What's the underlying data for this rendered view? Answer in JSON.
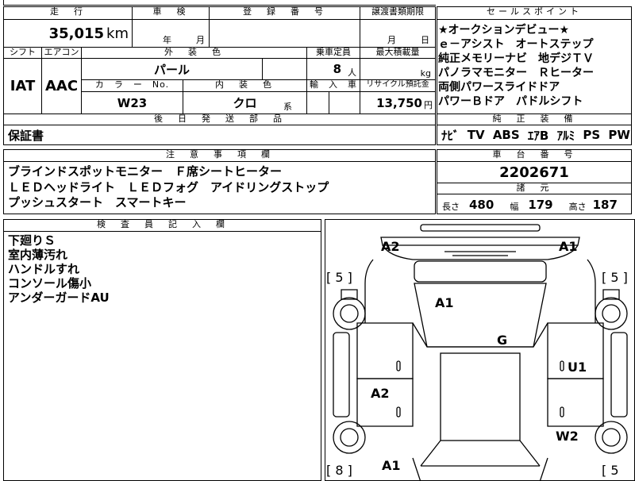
{
  "top_row": {
    "mileage_label": "走　行",
    "shaken_label": "車　検",
    "reg_label": "登　録　番　号",
    "transfer_label": "譲渡書類期限",
    "sales_label": "セールスポイント"
  },
  "mileage": {
    "value": "35,015",
    "unit": "km"
  },
  "shaken": {
    "year_unit": "年",
    "month_unit": "月"
  },
  "transfer": {
    "month_unit": "月",
    "day_unit": "日"
  },
  "row2_labels": {
    "shift": "シフト",
    "aircon": "エアコン",
    "exterior_color": "外　装　色",
    "capacity": "乗車定員",
    "max_load": "最大積載量"
  },
  "shift": "IAT",
  "aircon": "AAC",
  "exterior_color": "パール",
  "capacity": {
    "value": "8",
    "unit": "人"
  },
  "max_load": {
    "unit": "kg"
  },
  "row3_labels": {
    "color_no": "カ　ラ　ー　No.",
    "interior": "内　装　色",
    "import": "輸　入　車",
    "recycle": "リサイクル預託金"
  },
  "color_no": "W23",
  "interior": {
    "value": "クロ",
    "suffix": "系"
  },
  "recycle": {
    "value": "13,750",
    "unit": "円"
  },
  "sales_points": [
    "★オークションデビュー★",
    "ｅ－アシスト　オートステップ",
    "純正メモリーナビ　地デジＴＶ",
    "パノラマモニター　Ｒヒーター",
    "両側パワースライドドア",
    "パワーＢドア　パドルシフト"
  ],
  "later_parts": {
    "label": "後　日　発　送　部　品",
    "value": "保証書"
  },
  "std_equipment": {
    "label": "純　正　装　備",
    "items": [
      "ﾅﾋﾞ",
      "TV",
      "ABS",
      "ｴｱB",
      "ｱﾙﾐ",
      "PS",
      "PW"
    ]
  },
  "notes": {
    "label": "注　意　事　項　欄",
    "lines": [
      "ブラインドスポットモニター　Ｆ席シートヒーター",
      "ＬＥＤヘッドライト　ＬＥＤフォグ　アイドリングストップ",
      "プッシュスタート　スマートキー"
    ]
  },
  "chassis": {
    "label": "車　台　番　号",
    "value": "2202671"
  },
  "specs": {
    "label": "諸　元",
    "length_label": "長さ",
    "length": "480",
    "width_label": "幅",
    "width": "179",
    "height_label": "高さ",
    "height": "187"
  },
  "inspector": {
    "label": "検　査　員　記　入　欄",
    "lines": [
      "下廻りＳ",
      "室内薄汚れ",
      "ハンドルすれ",
      "コンソール傷小",
      "アンダーガードAU"
    ]
  },
  "diagram": {
    "codes": [
      "A2",
      "A1",
      "A1",
      "G",
      "U1",
      "A2",
      "W2",
      "A1"
    ],
    "tire_left_top": "[ 5 ]",
    "tire_right_top": "[ 5 ]",
    "tire_left_bottom": "[ 8 ]",
    "tire_right_bottom": "[ 5"
  }
}
